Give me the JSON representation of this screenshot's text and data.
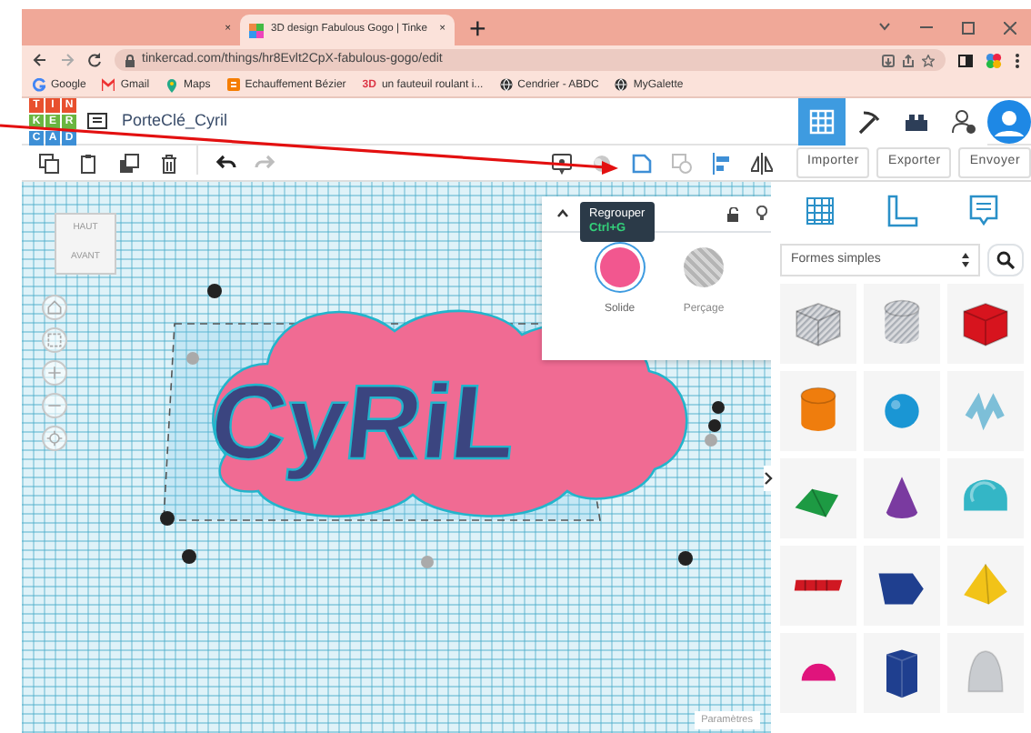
{
  "browser": {
    "tabs": [
      {
        "selected": false,
        "close": "×"
      },
      {
        "title": "3D design Fabulous Gogo | Tinke",
        "selected": true,
        "close": "×"
      }
    ],
    "new_tab": "+",
    "address": "tinkercad.com/things/hr8Evlt2CpX-fabulous-gogo/edit",
    "bookmarks": [
      {
        "kind": "google",
        "label": "Google"
      },
      {
        "kind": "gmail",
        "label": "Gmail"
      },
      {
        "kind": "maps",
        "label": "Maps"
      },
      {
        "kind": "blog",
        "label": "Echauffement Bézier"
      },
      {
        "kind": "text",
        "icon_text": "3D",
        "label": "un fauteuil roulant i..."
      },
      {
        "kind": "globe",
        "label": "Cendrier - ABDC"
      },
      {
        "kind": "globe",
        "label": "MyGalette"
      }
    ]
  },
  "app": {
    "logo_letters": [
      "T",
      "I",
      "N",
      "K",
      "E",
      "R",
      "C",
      "A",
      "D"
    ],
    "design_name": "PorteClé_Cyril",
    "views": [
      {
        "kind": "grid",
        "selected": true
      },
      {
        "kind": "pickaxe",
        "selected": false
      },
      {
        "kind": "bricks",
        "selected": false
      }
    ],
    "toolbar_left": [
      {
        "kind": "copy",
        "disabled": false
      },
      {
        "kind": "paste",
        "disabled": false
      },
      {
        "kind": "duplicate",
        "disabled": false
      },
      {
        "kind": "delete",
        "disabled": false
      },
      {
        "kind": "undo",
        "disabled": false
      },
      {
        "kind": "redo",
        "disabled": true
      }
    ],
    "toolbar_right": [
      {
        "kind": "note",
        "disabled": false
      },
      {
        "kind": "bulb",
        "disabled": true
      },
      {
        "kind": "group",
        "disabled": false
      },
      {
        "kind": "ungroup",
        "disabled": true
      },
      {
        "kind": "align",
        "disabled": false
      },
      {
        "kind": "mirror",
        "disabled": false
      }
    ],
    "actions": [
      {
        "label": "Importer"
      },
      {
        "label": "Exporter"
      },
      {
        "label": "Envoyer"
      }
    ],
    "tooltip": {
      "title": "Regrouper",
      "shortcut": "Ctrl+G"
    },
    "inspector": {
      "options": [
        {
          "label": "Solide",
          "selected": true,
          "color": "#f2578f"
        },
        {
          "label": "Perçage",
          "selected": false,
          "color": "#b5b5b5"
        }
      ]
    },
    "library": {
      "category": "Formes simples",
      "shapes": [
        {
          "kind": "box",
          "hole": true,
          "color": "#a9aeb5"
        },
        {
          "kind": "cylinder",
          "hole": true,
          "color": "#a9aeb5"
        },
        {
          "kind": "box",
          "hole": false,
          "color": "#d7141e"
        },
        {
          "kind": "cylinder",
          "hole": false,
          "color": "#ef7d0d"
        },
        {
          "kind": "sphere",
          "hole": false,
          "color": "#1a96d4"
        },
        {
          "kind": "squiggle",
          "hole": false,
          "color": "#7dbfd8"
        },
        {
          "kind": "roof",
          "hole": false,
          "color": "#1d9a43"
        },
        {
          "kind": "cone",
          "hole": false,
          "color": "#7a3aa0"
        },
        {
          "kind": "round-roof",
          "hole": false,
          "color": "#34b6c6"
        },
        {
          "kind": "letters",
          "hole": false,
          "color": "#d01822"
        },
        {
          "kind": "wedge",
          "hole": false,
          "color": "#1f3f8f"
        },
        {
          "kind": "pyramid",
          "hole": false,
          "color": "#f2c318"
        },
        {
          "kind": "half-sphere",
          "hole": false,
          "color": "#e0147c"
        },
        {
          "kind": "polygon",
          "hole": false,
          "color": "#1f3f8f"
        },
        {
          "kind": "paraboloid",
          "hole": false,
          "color": "#c9ccd0"
        }
      ]
    },
    "viewcube": {
      "top": "HAUT",
      "front": "AVANT"
    },
    "model": {
      "label": "CyRiL"
    },
    "settings": "Paramètres"
  }
}
